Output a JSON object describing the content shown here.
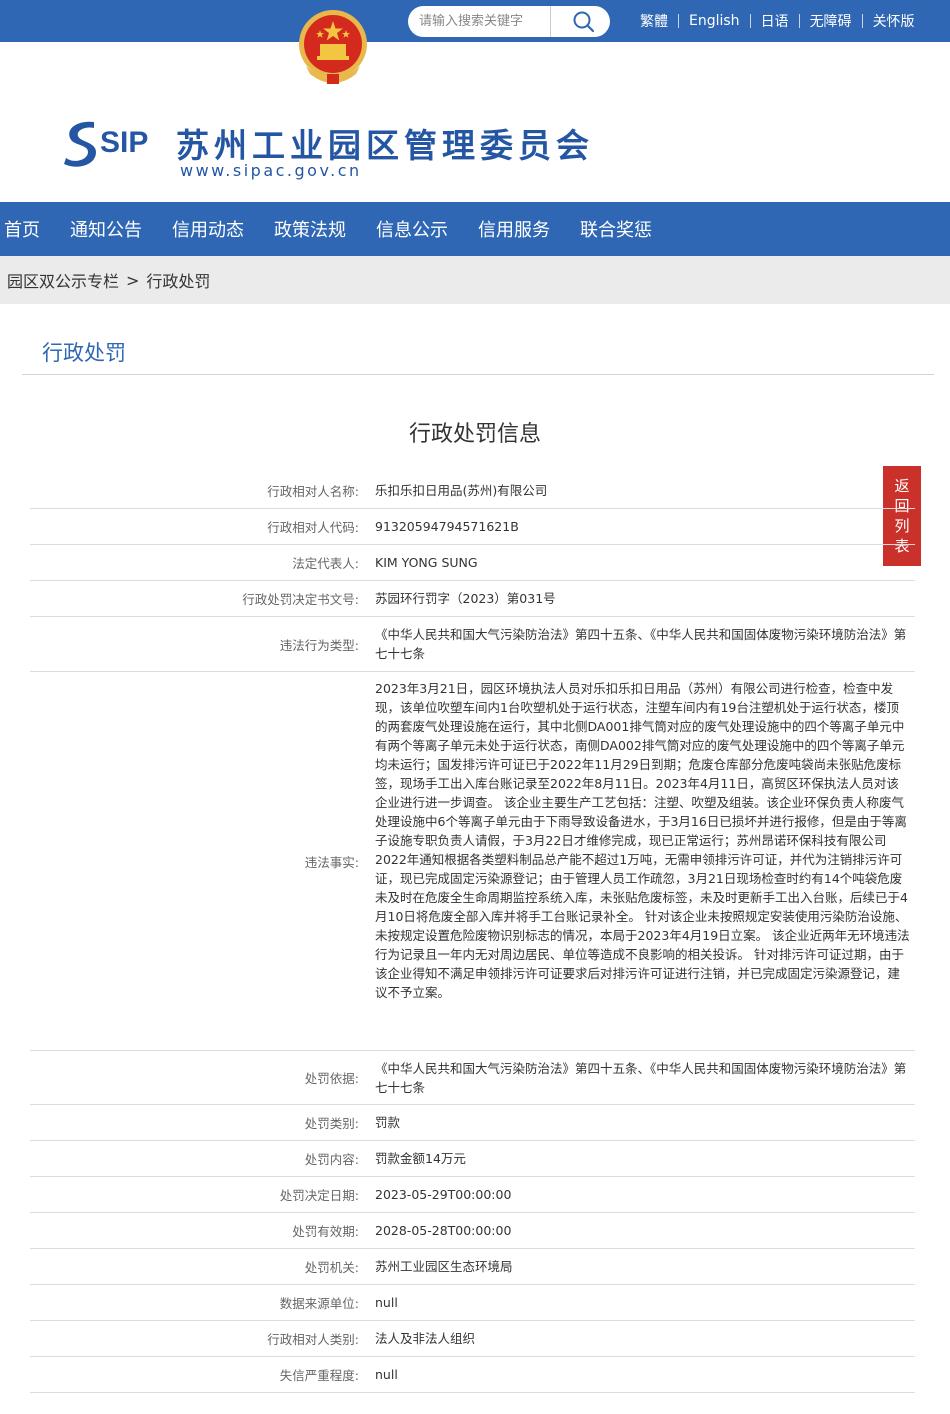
{
  "header": {
    "search_placeholder": "请输入搜索关键字",
    "languages": [
      "繁體",
      "English",
      "日语",
      "无障碍",
      "关怀版"
    ],
    "logo_text": "SIP",
    "site_title": "苏州工业园区管理委员会",
    "site_url": "www.sipac.gov.cn"
  },
  "nav": {
    "items": [
      "首页",
      "通知公告",
      "信用动态",
      "政策法规",
      "信息公示",
      "信用服务",
      "联合奖惩"
    ]
  },
  "breadcrumb": {
    "items": [
      "园区双公示专栏",
      "行政处罚"
    ],
    "separator": ">"
  },
  "section_title": "行政处罚",
  "main_title": "行政处罚信息",
  "back_button": [
    "返",
    "回",
    "列",
    "表"
  ],
  "record": [
    {
      "label": "行政相对人名称:",
      "value": "乐扣乐扣日用品(苏州)有限公司"
    },
    {
      "label": "行政相对人代码:",
      "value": "91320594794571621B"
    },
    {
      "label": "法定代表人:",
      "value": "KIM YONG SUNG"
    },
    {
      "label": "行政处罚决定书文号:",
      "value": "苏园环行罚字（2023）第031号"
    },
    {
      "label": "违法行为类型:",
      "value": "《中华人民共和国大气污染防治法》第四十五条、《中华人民共和国固体废物污染环境防治法》第七十七条"
    },
    {
      "label": "违法事实:",
      "value": "2023年3月21日，园区环境执法人员对乐扣乐扣日用品（苏州）有限公司进行检查，检查中发现，该单位吹塑车间内1台吹塑机处于运行状态，注塑车间内有19台注塑机处于运行状态，楼顶的两套废气处理设施在运行，其中北侧DA001排气筒对应的废气处理设施中的四个等离子单元中有两个等离子单元未处于运行状态，南侧DA002排气筒对应的废气处理设施中的四个等离子单元均未运行；国发排污许可证已于2022年11月29日到期；危废仓库部分危废吨袋尚未张贴危废标签，现场手工出入库台账记录至2022年8月11日。2023年4月11日，高贸区环保执法人员对该企业进行进一步调查。 该企业主要生产工艺包括：注塑、吹塑及组装。该企业环保负责人称废气处理设施中6个等离子单元由于下雨导致设备进水，于3月16日已损坏并进行报修，但是由于等离子设施专职负责人请假，于3月22日才维修完成，现已正常运行；苏州昂诺环保科技有限公司2022年通知根据各类塑料制品总产能不超过1万吨，无需申领排污许可证，并代为注销排污许可证，现已完成固定污染源登记；由于管理人员工作疏忽，3月21日现场检查时约有14个吨袋危废未及时在危废全生命周期监控系统入库，未张贴危废标签，未及时更新手工出入台账，后续已于4月10日将危废全部入库并将手工台账记录补全。 针对该企业未按照规定安装使用污染防治设施、未按规定设置危险废物识别标志的情况，本局于2023年4月19日立案。 该企业近两年无环境违法行为记录且一年内无对周边居民、单位等造成不良影响的相关投诉。 针对排污许可证过期，由于该企业得知不满足申领排污许可证要求后对排污许可证进行注销，并已完成固定污染源登记，建议不予立案。"
    },
    {
      "label": "处罚依据:",
      "value": "《中华人民共和国大气污染防治法》第四十五条、《中华人民共和国固体废物污染环境防治法》第七十七条"
    },
    {
      "label": "处罚类别:",
      "value": "罚款"
    },
    {
      "label": "处罚内容:",
      "value": "罚款金额14万元"
    },
    {
      "label": "处罚决定日期:",
      "value": "2023-05-29T00:00:00"
    },
    {
      "label": "处罚有效期:",
      "value": "2028-05-28T00:00:00"
    },
    {
      "label": "处罚机关:",
      "value": "苏州工业园区生态环境局"
    },
    {
      "label": "数据来源单位:",
      "value": "null"
    },
    {
      "label": "行政相对人类别:",
      "value": "法人及非法人组织"
    },
    {
      "label": "失信严重程度:",
      "value": "null"
    }
  ]
}
